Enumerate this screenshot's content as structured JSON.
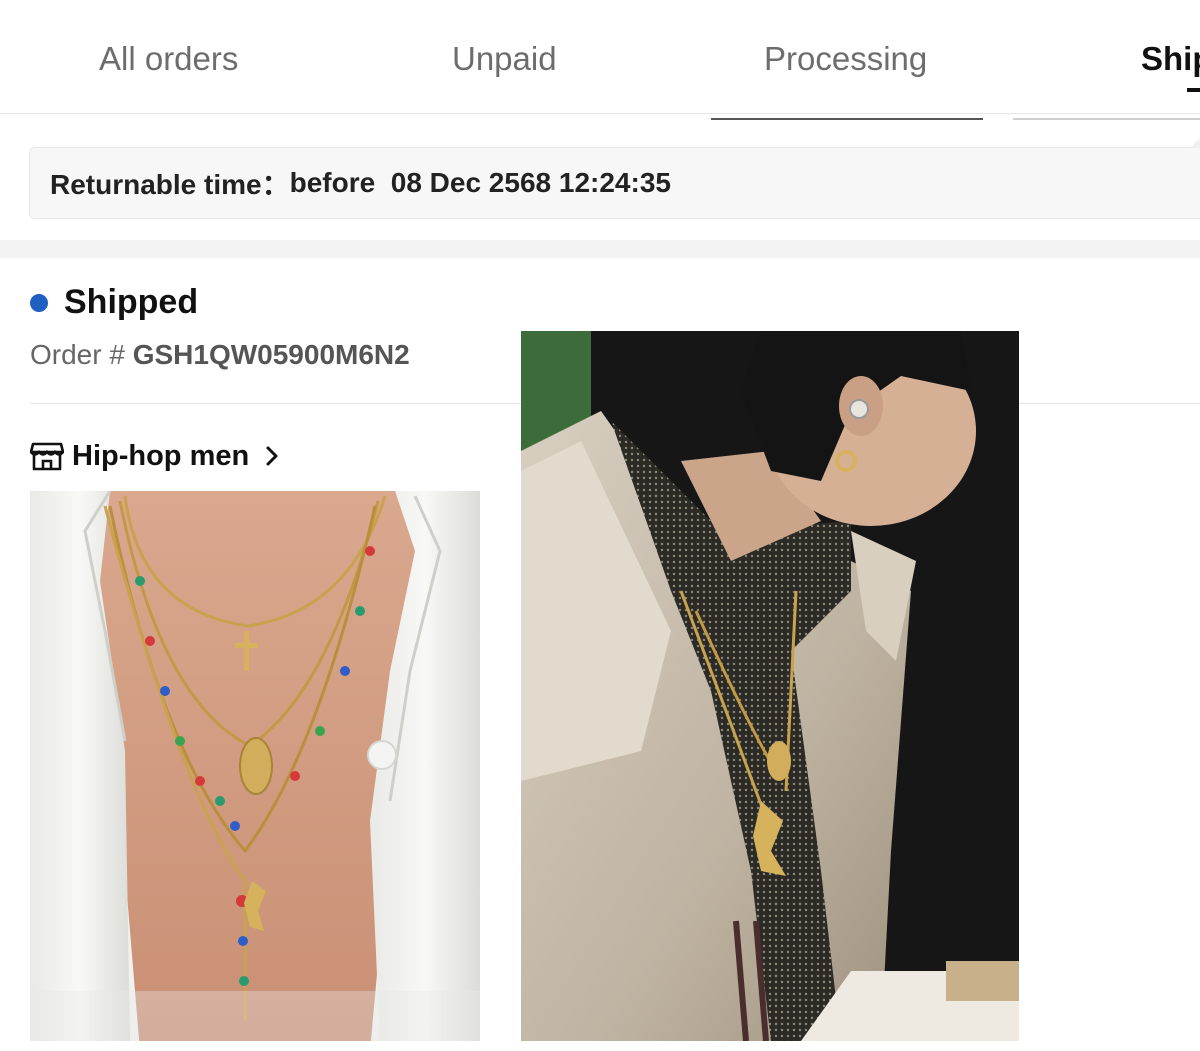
{
  "tabs": [
    {
      "label": "All orders",
      "active": false
    },
    {
      "label": "Unpaid",
      "active": false
    },
    {
      "label": "Processing",
      "active": false
    },
    {
      "label": "Ship",
      "active": true
    }
  ],
  "return_window": {
    "label": "Returnable time：",
    "value": "before  08 Dec 2568 12:24:35"
  },
  "order": {
    "status": "Shipped",
    "status_color": "#1f5fbf",
    "number_label": "Order # ",
    "number": "GSH1QW05900M6N2"
  },
  "store": {
    "icon": "store-icon",
    "name": "Hip-hop men",
    "chevron_icon": "chevron-right-icon"
  },
  "images": [
    {
      "subject": "product-photo-layered-necklaces"
    },
    {
      "subject": "customer-photo-necklaces-worn"
    }
  ]
}
